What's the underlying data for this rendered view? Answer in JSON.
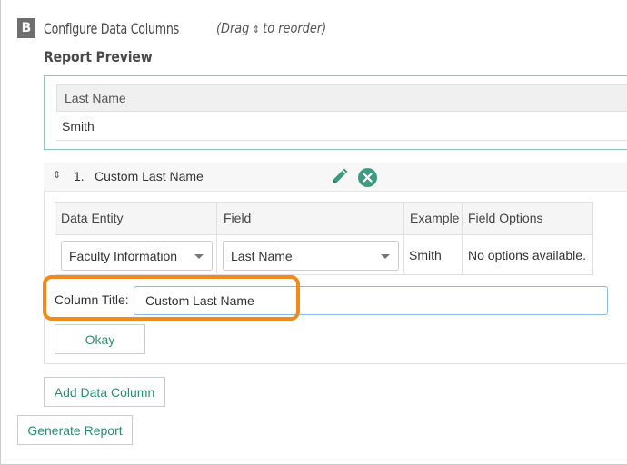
{
  "section": {
    "badge": "B",
    "title": "Configure Data Columns",
    "hint_prefix": "(Drag",
    "hint_arrow": "⇕",
    "hint_suffix": "to reorder)"
  },
  "preview": {
    "heading": "Report Preview",
    "column_header": "Last Name",
    "row_value": "Smith"
  },
  "column": {
    "number": "1.",
    "name": "Custom Last Name",
    "headers": {
      "data_entity": "Data Entity",
      "field": "Field",
      "example": "Example",
      "field_options": "Field Options"
    },
    "data_entity_selected": "Faculty Information",
    "field_selected": "Last Name",
    "example_value": "Smith",
    "field_options_value": "No options available.",
    "title_label": "Column Title:",
    "title_value": "Custom Last Name",
    "okay_label": "Okay"
  },
  "actions": {
    "add_column_label": "Add Data Column",
    "generate_label": "Generate Report"
  },
  "colors": {
    "accent": "#2f8a74",
    "icon_green": "#3e9b82",
    "highlight_orange": "#ef8a1d"
  }
}
